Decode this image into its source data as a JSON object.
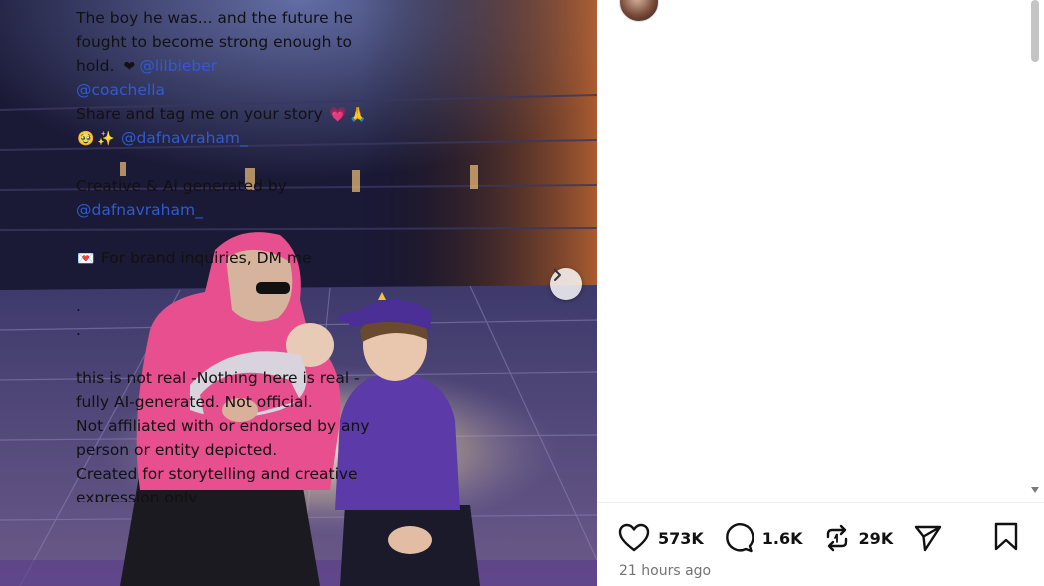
{
  "post": {
    "caption_lines": [
      {
        "text": "The boy he was... and the future he"
      },
      {
        "text": "fought to become strong enough to"
      },
      {
        "text": "hold. ",
        "emoji": "❤",
        "mention": "@lilbieber"
      },
      {
        "mention": "@coachella"
      },
      {
        "text": "Share and tag me on your story ",
        "emoji": "💗",
        "emoji2": "🙏"
      },
      {
        "emoji": "🥹",
        "emoji2": "✨",
        "mention": "@dafnavraham_"
      },
      {
        "blank": true
      },
      {
        "text": "Creative & Ai generated by"
      },
      {
        "mention": "@dafnavraham_"
      },
      {
        "blank": true
      },
      {
        "emoji": "💌",
        "text": " For brand inquiries, DM me"
      },
      {
        "blank": true
      },
      {
        "text": "."
      },
      {
        "text": "."
      },
      {
        "blank": true
      },
      {
        "text": "this is not real -Nothing here is real -"
      },
      {
        "text": "fully AI-generated. Not official."
      },
      {
        "text": "Not affiliated with or endorsed by any"
      },
      {
        "text": "person or entity depicted."
      },
      {
        "text": "Created for storytelling and creative"
      },
      {
        "text": "expression only"
      }
    ],
    "likes": "573K",
    "comments": "1.6K",
    "reposts": "29K",
    "timestamp": "21 hours ago"
  },
  "icons": {
    "like": "heart-icon",
    "comment": "comment-icon",
    "repost": "repost-icon",
    "share": "send-icon",
    "save": "bookmark-icon",
    "next": "chevron-right-icon"
  },
  "colors": {
    "mention": "#2f5bd3",
    "hoodie_pink": "#e84f8e",
    "hoodie_purple": "#5c3aa8",
    "timestamp": "#737373"
  }
}
